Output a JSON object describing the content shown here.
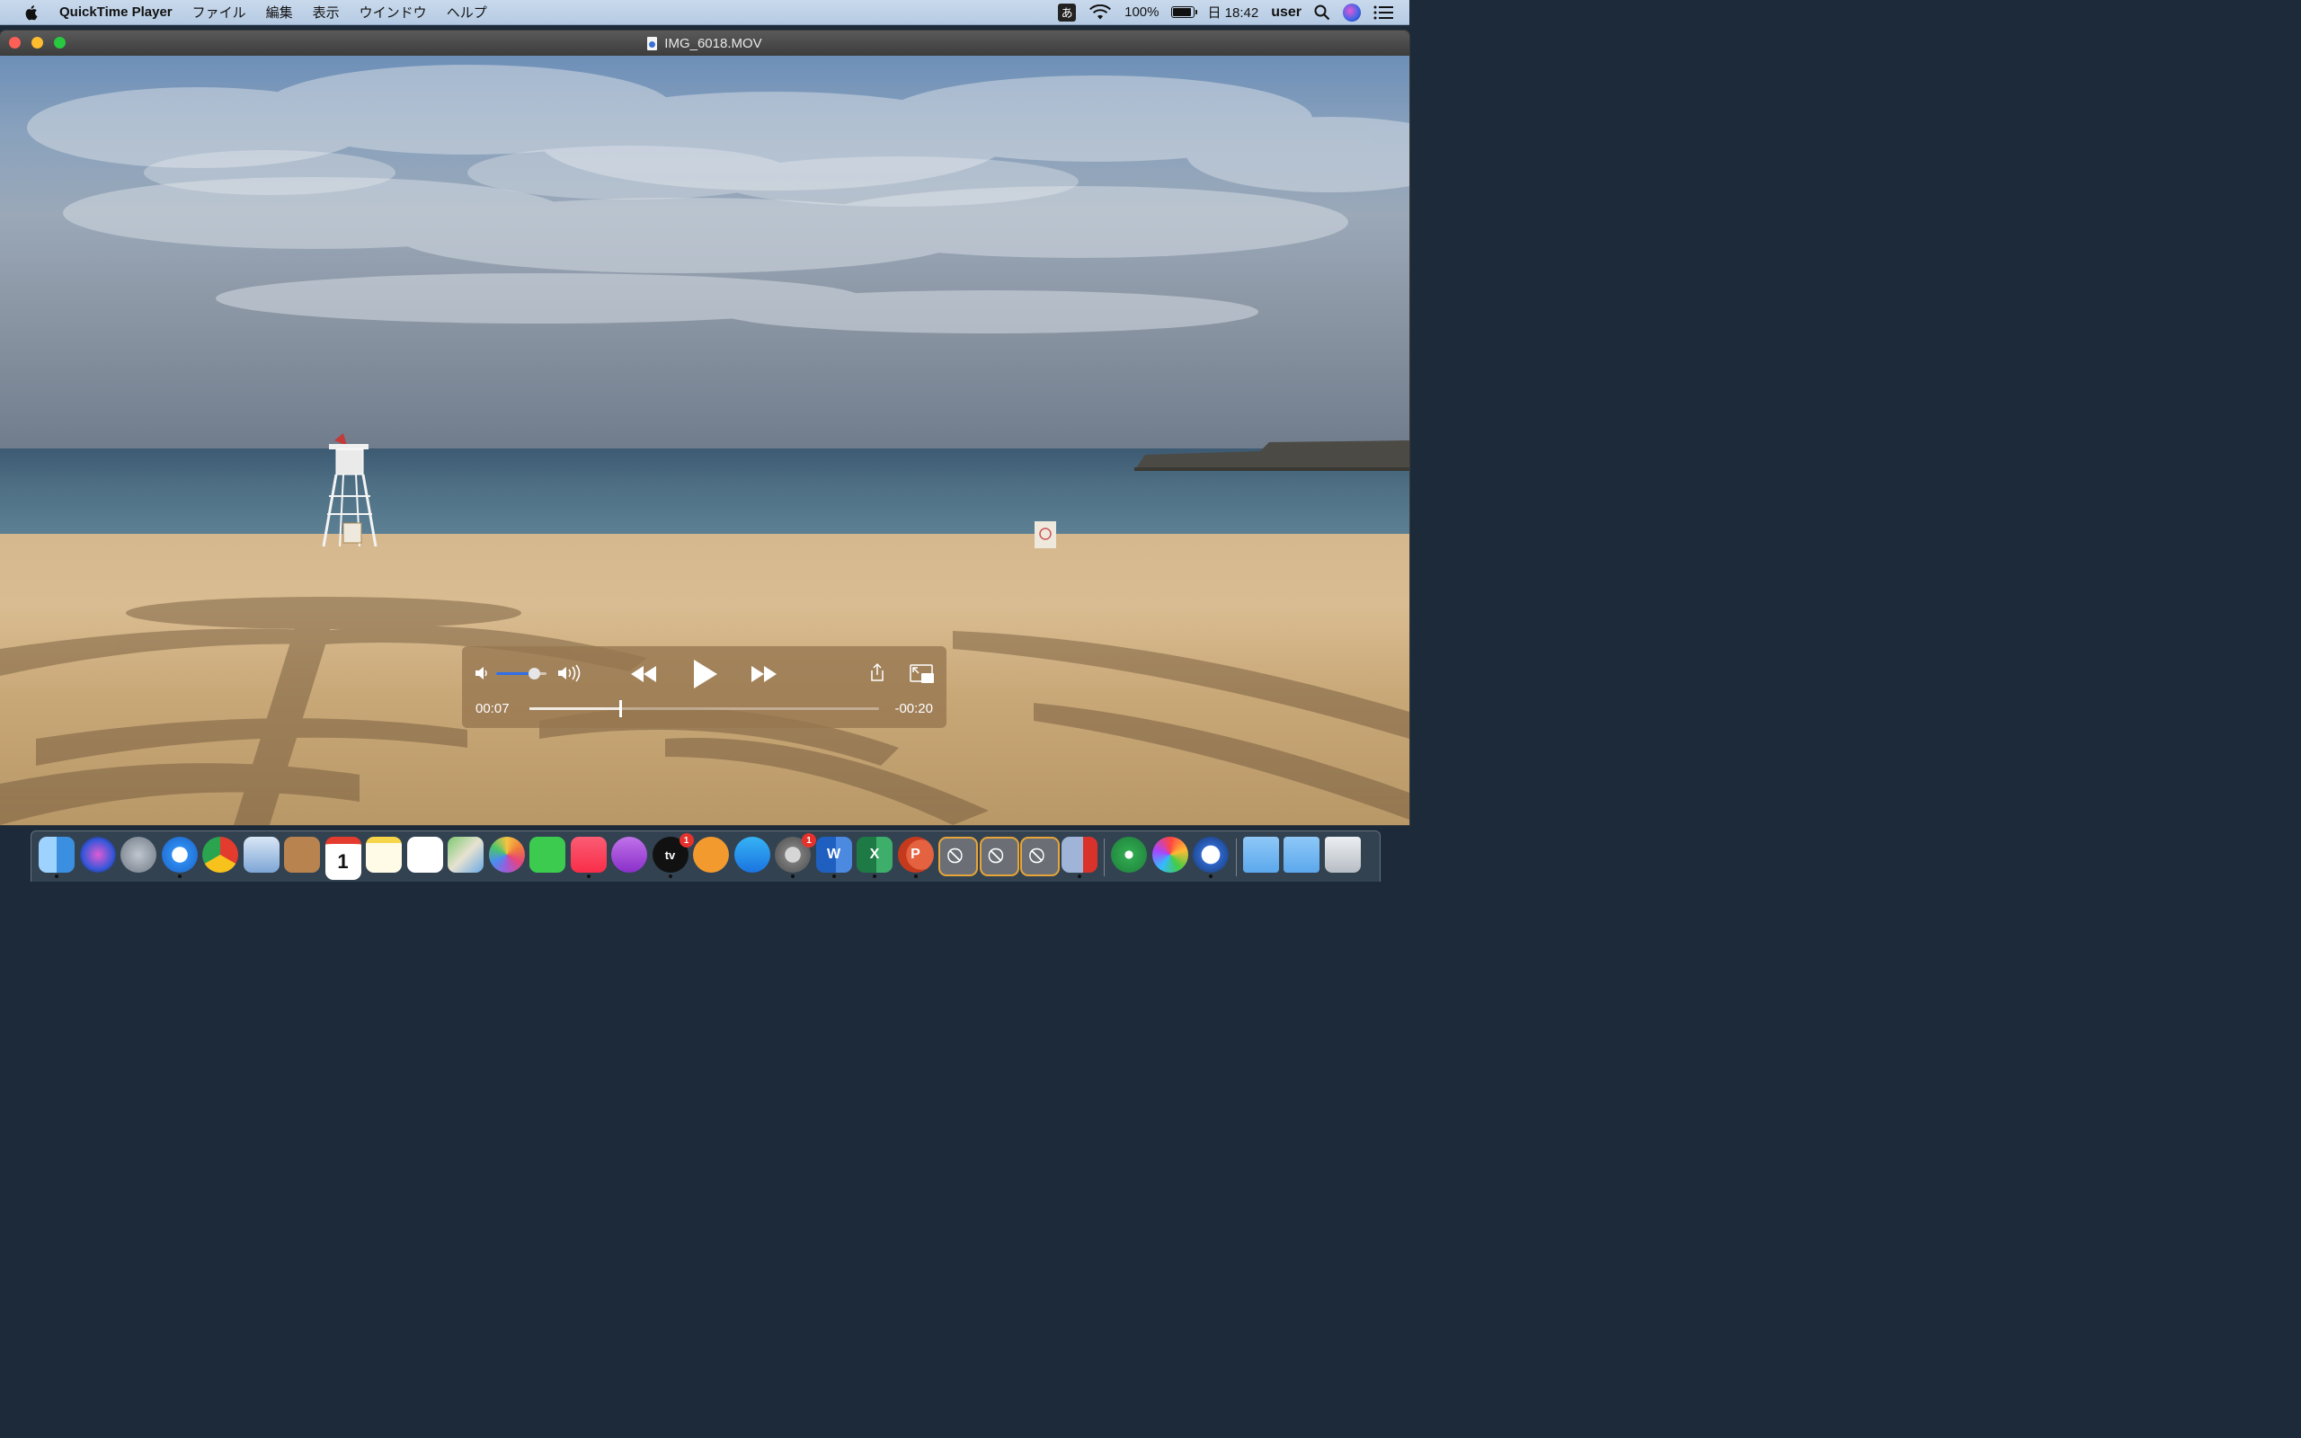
{
  "menubar": {
    "app_name": "QuickTime Player",
    "menus": [
      "ファイル",
      "編集",
      "表示",
      "ウインドウ",
      "ヘルプ"
    ],
    "ime": "あ",
    "battery": "100%",
    "battery_level": 1.0,
    "datetime": "日 18:42",
    "user": "user"
  },
  "window": {
    "title": "IMG_6018.MOV",
    "traffic_lights": {
      "close": "#fe5f57",
      "minimize": "#febc2e",
      "zoom": "#28c840"
    }
  },
  "player": {
    "elapsed": "00:07",
    "remaining": "-00:20",
    "progress": 0.26,
    "volume": 0.75,
    "accent": "#2f6fe8"
  },
  "dock": {
    "items": [
      {
        "name": "finder",
        "icon": "finder-icon",
        "running": true
      },
      {
        "name": "siri",
        "icon": "siri-icon",
        "running": false
      },
      {
        "name": "launchpad",
        "icon": "launchpad-icon",
        "running": false
      },
      {
        "name": "safari",
        "icon": "safari-icon",
        "running": true
      },
      {
        "name": "chrome",
        "icon": "chrome-icon",
        "running": false
      },
      {
        "name": "mail",
        "icon": "mail-icon",
        "running": false
      },
      {
        "name": "contacts",
        "icon": "contacts-icon",
        "running": false
      },
      {
        "name": "calendar",
        "icon": "calendar-icon",
        "running": false,
        "label": "1"
      },
      {
        "name": "notes",
        "icon": "notes-icon",
        "running": false
      },
      {
        "name": "reminders",
        "icon": "reminders-icon",
        "running": false
      },
      {
        "name": "maps",
        "icon": "maps-icon",
        "running": false
      },
      {
        "name": "photos",
        "icon": "photos-icon",
        "running": false
      },
      {
        "name": "facetime",
        "icon": "facetime-icon",
        "running": false
      },
      {
        "name": "music",
        "icon": "music-icon",
        "running": true
      },
      {
        "name": "podcasts",
        "icon": "podcasts-icon",
        "running": false
      },
      {
        "name": "tv",
        "icon": "tv-icon",
        "running": true,
        "badge": "1",
        "label": "tv"
      },
      {
        "name": "books",
        "icon": "books-icon",
        "running": false
      },
      {
        "name": "app-store",
        "icon": "app-store-icon",
        "running": false
      },
      {
        "name": "system-preferences",
        "icon": "gear-icon",
        "running": true,
        "badge": "1"
      },
      {
        "name": "word",
        "icon": "word-icon",
        "running": true,
        "label": "W"
      },
      {
        "name": "excel",
        "icon": "excel-icon",
        "running": true,
        "label": "X"
      },
      {
        "name": "powerpoint",
        "icon": "powerpoint-icon",
        "running": true,
        "label": "P"
      },
      {
        "name": "blocked-app-1",
        "icon": "prohibited-icon",
        "running": false
      },
      {
        "name": "blocked-app-2",
        "icon": "prohibited-icon",
        "running": false
      },
      {
        "name": "blocked-app-3",
        "icon": "prohibited-icon",
        "running": false
      },
      {
        "name": "parallels",
        "icon": "parallels-icon",
        "running": true
      },
      {
        "name": "app-green",
        "icon": "disk-icon",
        "running": false
      },
      {
        "name": "app-color",
        "icon": "wheel-icon",
        "running": false
      },
      {
        "name": "quicktime",
        "icon": "quicktime-icon",
        "running": true
      },
      {
        "name": "folder-1",
        "icon": "folder-icon",
        "running": false
      },
      {
        "name": "folder-2",
        "icon": "folder-icon",
        "running": false
      },
      {
        "name": "trash",
        "icon": "trash-icon",
        "running": false
      }
    ]
  }
}
